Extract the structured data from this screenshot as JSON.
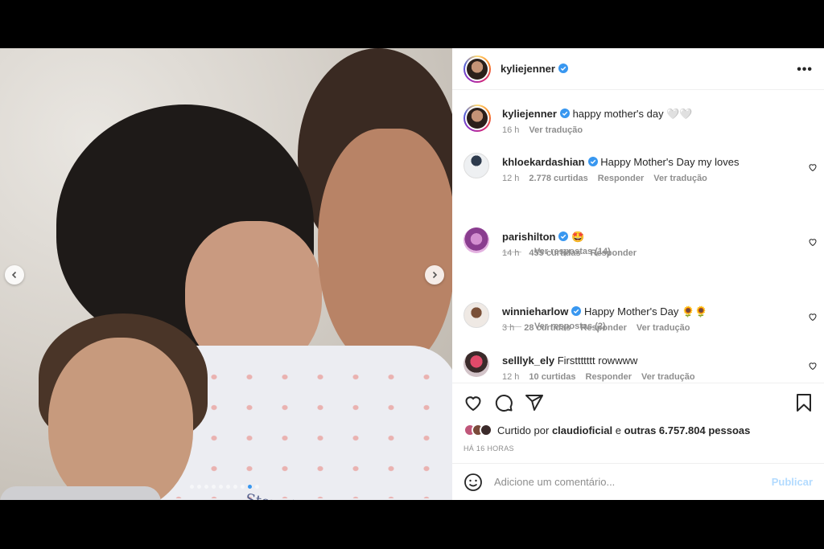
{
  "post": {
    "author": "kyliejenner",
    "caption": "happy mother's day 🤍🤍",
    "age": "16 h",
    "translate": "Ver tradução",
    "photo_text": "Stormi",
    "carousel": {
      "count": 10,
      "active_index": 8
    }
  },
  "comments": [
    {
      "user": "khloekardashian",
      "verified": true,
      "text": "Happy Mother's Day my loves",
      "age": "12 h",
      "likes": "2.778 curtidas",
      "reply": "Responder",
      "translate": "Ver tradução",
      "replies": "Ver respostas (14)"
    },
    {
      "user": "parishilton",
      "verified": true,
      "text": "🤩",
      "age": "14 h",
      "likes": "455 curtidas",
      "reply": "Responder",
      "replies": "Ver respostas (2)"
    },
    {
      "user": "winnieharlow",
      "verified": true,
      "text": "Happy Mother's Day 🌻🌻",
      "age": "3 h",
      "likes": "28 curtidas",
      "reply": "Responder",
      "translate": "Ver tradução"
    },
    {
      "user": "selllyk_ely",
      "verified": false,
      "text": "Firsttttttt rowwww",
      "age": "12 h",
      "likes": "10 curtidas",
      "reply": "Responder",
      "translate": "Ver tradução"
    }
  ],
  "likes": {
    "prefix": "Curtido por",
    "user": "claudioficial",
    "mid": "e",
    "others": "outras 6.757.804 pessoas"
  },
  "time_ago": "HÁ 16 HORAS",
  "comment_box": {
    "placeholder": "Adicione um comentário...",
    "publish": "Publicar"
  },
  "colors": {
    "verified": "#3897f0",
    "publish": "#b3dbff",
    "muted": "#8e8e8e"
  },
  "icons": [
    "more-icon",
    "heart-icon",
    "comment-icon",
    "share-icon",
    "bookmark-icon",
    "emoji-icon",
    "chevron-left-icon",
    "chevron-right-icon"
  ]
}
